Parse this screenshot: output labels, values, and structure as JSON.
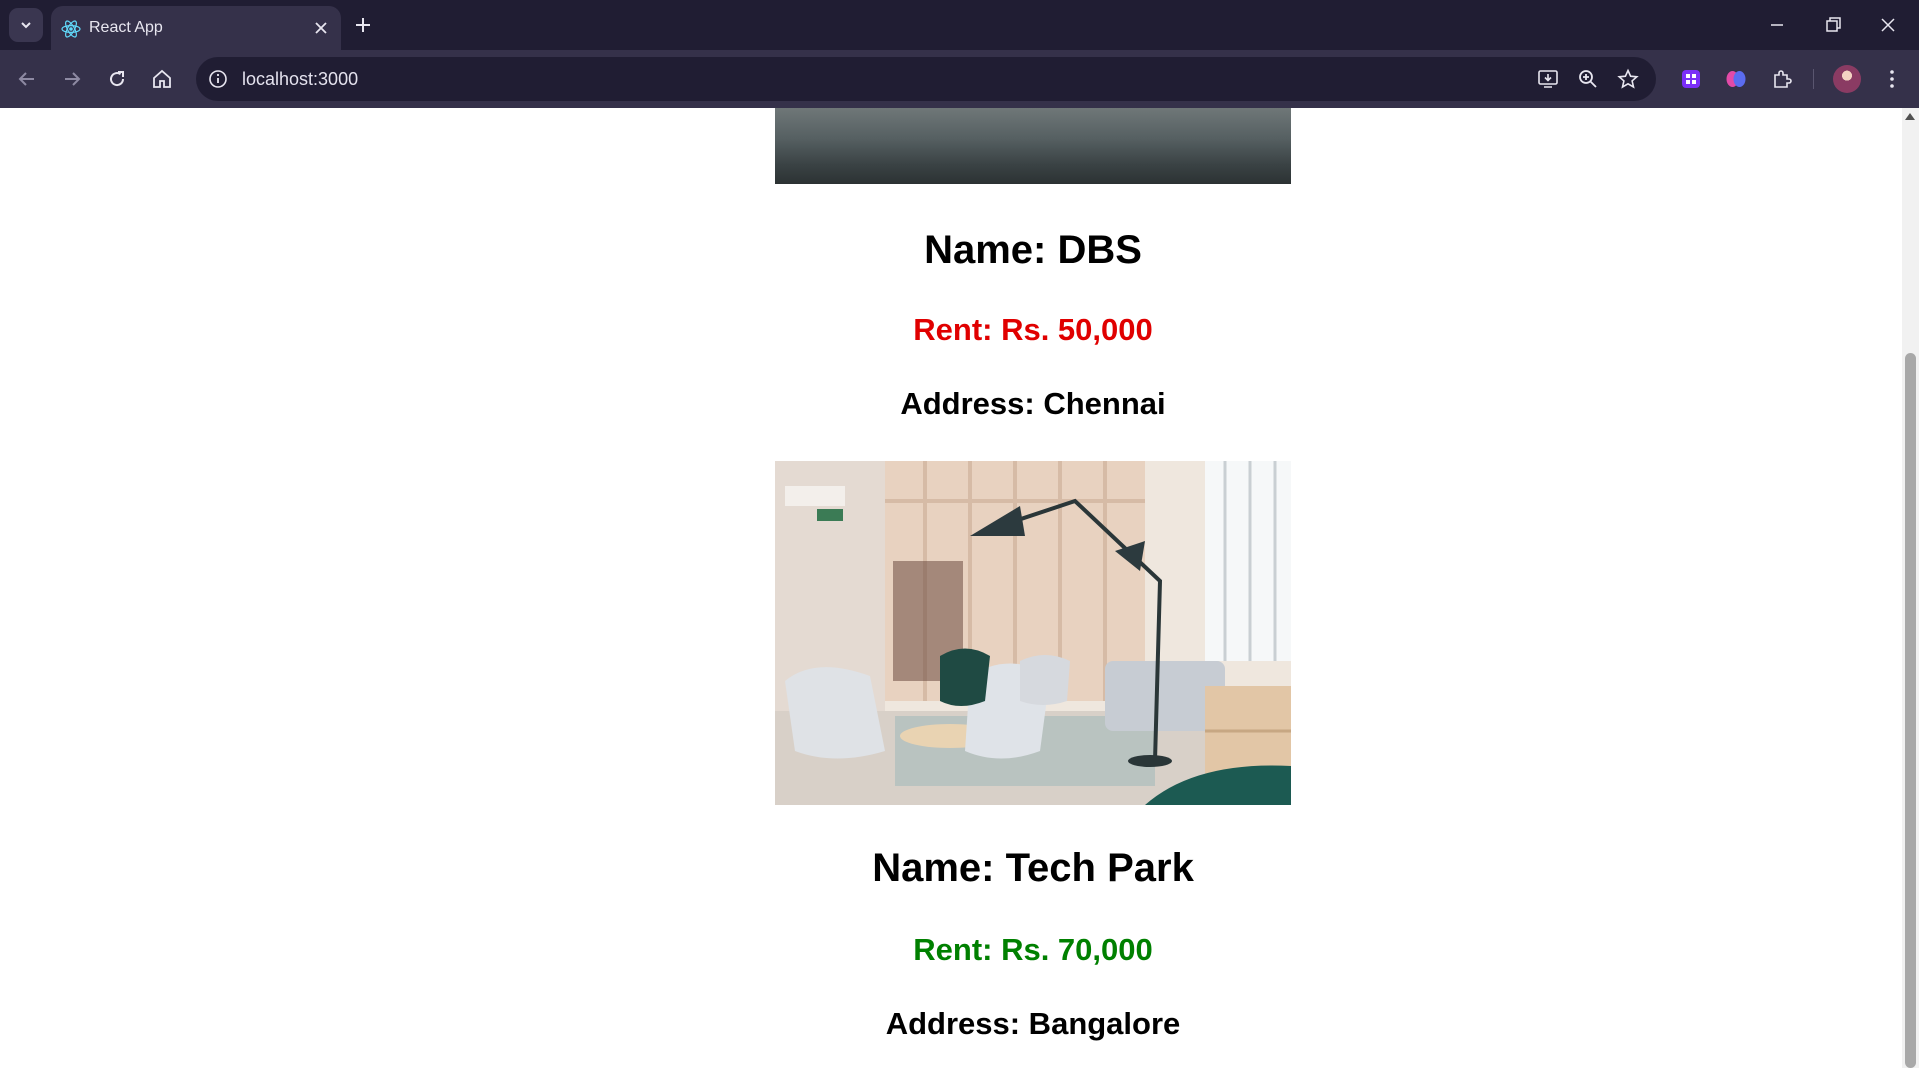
{
  "browser": {
    "tab_title": "React App",
    "url": "localhost:3000"
  },
  "icons": {
    "tab_search": "chevron-down-icon",
    "favicon": "react-icon",
    "tab_close": "close-icon",
    "new_tab": "plus-icon",
    "minimize": "minimize-icon",
    "restore": "restore-icon",
    "close_window": "close-icon",
    "back": "arrow-left-icon",
    "forward": "arrow-right-icon",
    "reload": "reload-icon",
    "home": "home-icon",
    "site_info": "info-icon",
    "install": "install-icon",
    "zoom": "zoom-icon",
    "bookmark": "star-icon",
    "extensions": "puzzle-icon"
  },
  "colors": {
    "rent_high": "#e00000",
    "rent_low": "#008000"
  },
  "listings": [
    {
      "name": "Name: DBS",
      "rent": "Rent: Rs. 50,000",
      "address": "Address: Chennai"
    },
    {
      "name": "Name: Tech Park",
      "rent": "Rent: Rs. 70,000",
      "address": "Address: Bangalore"
    }
  ]
}
